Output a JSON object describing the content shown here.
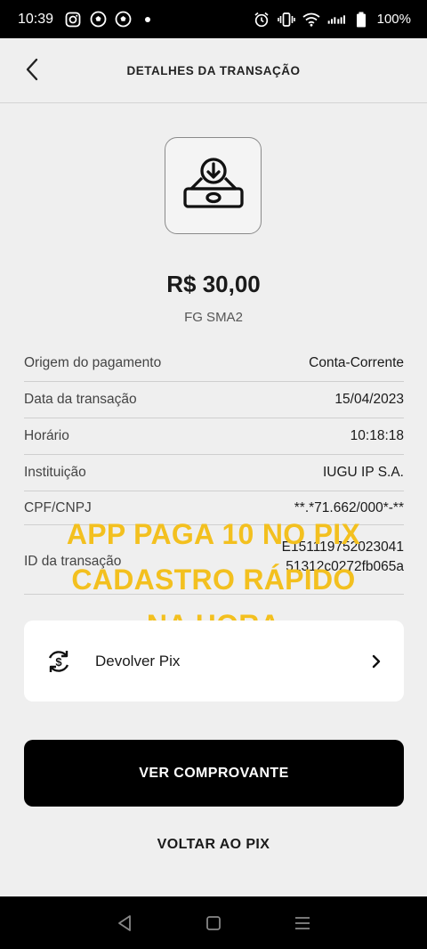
{
  "status_bar": {
    "time": "10:39",
    "battery": "100%",
    "left_icons": [
      "instagram-icon",
      "soccer-ball-icon",
      "soccer-ball-icon",
      "dot-icon"
    ],
    "right_icons": [
      "alarm-icon",
      "vibrate-icon",
      "wifi-icon",
      "signal-icon",
      "battery-icon"
    ]
  },
  "header": {
    "title": "DETALHES DA TRANSAÇÃO",
    "back_icon": "chevron-left-icon"
  },
  "transaction": {
    "icon": "money-tray-download-icon",
    "amount": "R$ 30,00",
    "recipient": "FG SMA2"
  },
  "details": [
    {
      "label": "Origem do pagamento",
      "value": "Conta-Corrente"
    },
    {
      "label": "Data da transação",
      "value": "15/04/2023"
    },
    {
      "label": "Horário",
      "value": "10:18:18"
    },
    {
      "label": "Instituição",
      "value": "IUGU IP S.A."
    },
    {
      "label": "CPF/CNPJ",
      "value": "**.*71.662/000*-**"
    },
    {
      "label": "ID da transação",
      "value_line1": "E151119752023041",
      "value_line2": "51312c0272fb065a"
    }
  ],
  "overlay": {
    "line1": "APP PAGA 10 NO PIX",
    "line2": "CADASTRO RÁPIDO",
    "line3": "NA HORA",
    "color": "#f3c01f"
  },
  "pix_action": {
    "label": "Devolver Pix",
    "icon": "refund-dollar-icon",
    "chevron": "chevron-right-icon"
  },
  "buttons": {
    "primary": "VER COMPROVANTE",
    "secondary": "VOLTAR AO PIX"
  },
  "nav_bar": {
    "icons": [
      "back-triangle-icon",
      "home-square-icon",
      "recents-lines-icon"
    ]
  }
}
